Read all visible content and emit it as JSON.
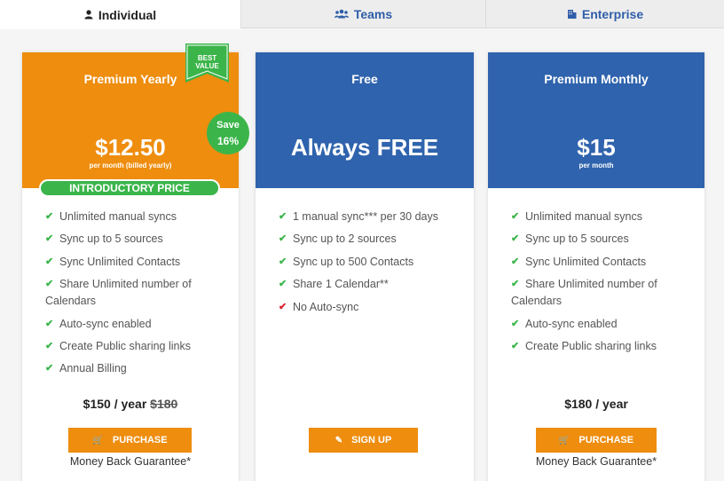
{
  "tabs": {
    "individual": {
      "label": "Individual",
      "icon": "person-icon"
    },
    "teams": {
      "label": "Teams",
      "icon": "users-icon"
    },
    "enterprise": {
      "label": "Enterprise",
      "icon": "building-icon"
    }
  },
  "colors": {
    "orange": "#ee8d0e",
    "blue": "#2f63ad",
    "green": "#3bb54a",
    "red": "#d9232d"
  },
  "plans": {
    "yearly": {
      "title": "Premium Yearly",
      "price": "$12.50",
      "price_sub": "per month (billed yearly)",
      "ribbon_line1": "BEST",
      "ribbon_line2": "VALUE",
      "save_label": "Save",
      "save_pct": "16%",
      "intro": "INTRODUCTORY PRICE",
      "features": [
        "Unlimited manual syncs",
        "Sync up to 5 sources",
        "Sync Unlimited Contacts",
        "Share Unlimited number of",
        "Calendars",
        "Auto-sync enabled",
        "Create Public sharing links",
        "Annual Billing"
      ],
      "annual_price": "$150 / year",
      "annual_old": "$180",
      "button": "PURCHASE",
      "guarantee": "Money Back Guarantee*"
    },
    "free": {
      "title": "Free",
      "price": "Always FREE",
      "features": [
        "1 manual sync*** per 30 days",
        "Sync up to 2 sources",
        "Sync up to 500 Contacts",
        "Share 1 Calendar**",
        "No Auto-sync"
      ],
      "button": "SIGN UP"
    },
    "monthly": {
      "title": "Premium Monthly",
      "price": "$15",
      "price_sub": "per month",
      "features": [
        "Unlimited manual syncs",
        "Sync up to 5 sources",
        "Sync Unlimited Contacts",
        "Share Unlimited number of",
        "Calendars",
        "Auto-sync enabled",
        "Create Public sharing links"
      ],
      "annual_price": "$180 / year",
      "button": "PURCHASE",
      "guarantee": "Money Back Guarantee*"
    }
  }
}
